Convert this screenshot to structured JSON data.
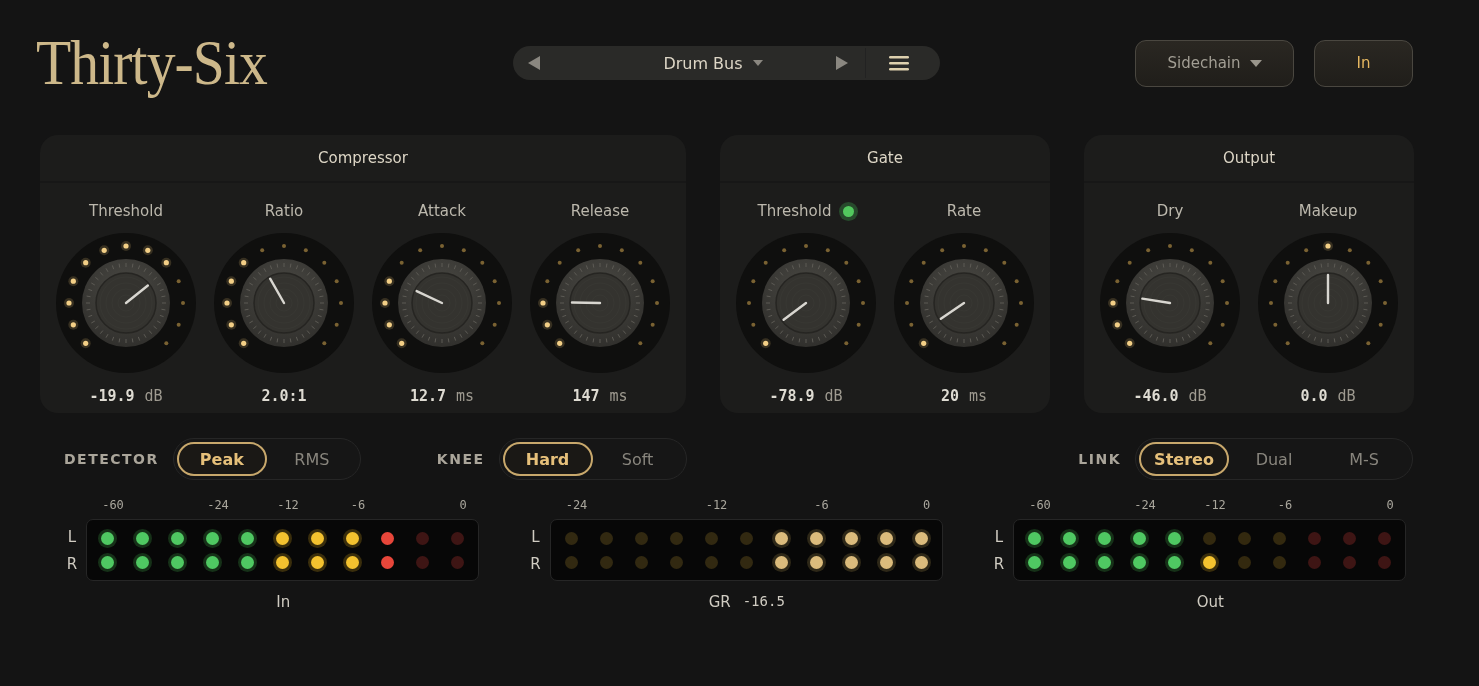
{
  "header": {
    "title": "Thirty-Six",
    "preset": {
      "name": "Drum Bus"
    },
    "sidechain": {
      "label": "Sidechain"
    },
    "bypass": {
      "label": "In",
      "on": true
    }
  },
  "sections": [
    {
      "title": "Compressor",
      "knobs": [
        {
          "label": "Threshold",
          "value": "-19.9",
          "unit": "dB"
        },
        {
          "label": "Ratio",
          "value": "2.0:1"
        },
        {
          "label": "Attack",
          "value": "12.7",
          "unit": "ms"
        },
        {
          "label": "Release",
          "value": "147",
          "unit": "ms"
        }
      ]
    },
    {
      "title": "Gate",
      "knobs": [
        {
          "label": "Threshold",
          "indicator": {
            "on": true
          },
          "value": "-78.9",
          "unit": "dB"
        },
        {
          "label": "Rate",
          "value": "20",
          "unit": "ms"
        }
      ]
    },
    {
      "title": "Output",
      "knobs": [
        {
          "label": "Dry",
          "value": "-46.0",
          "unit": "dB"
        },
        {
          "label": "Makeup",
          "value": "0.0",
          "unit": "dB"
        }
      ]
    }
  ],
  "modes": [
    {
      "label": "DETECTOR",
      "options": [
        {
          "label": "Peak",
          "selected": true
        },
        {
          "label": "RMS",
          "selected": false
        }
      ]
    },
    {
      "label": "KNEE",
      "options": [
        {
          "label": "Hard",
          "selected": true
        },
        {
          "label": "Soft",
          "selected": false
        }
      ]
    },
    {
      "label": "LINK",
      "options": [
        {
          "label": "Stereo",
          "selected": true
        },
        {
          "label": "Dual",
          "selected": false
        },
        {
          "label": "M-S",
          "selected": false
        }
      ]
    }
  ],
  "meters": [
    {
      "kind": "level",
      "ticks": [
        "-60",
        "-24",
        "-12",
        "-6",
        "0"
      ],
      "channels": [
        {
          "label": "L",
          "level": 0.818
        },
        {
          "label": "R",
          "level": 0.818
        }
      ],
      "caption": "In"
    },
    {
      "kind": "reduction",
      "ticks": [
        "-24",
        "-12",
        "-6",
        "0"
      ],
      "channels": [
        {
          "label": "L",
          "level": 0.455
        },
        {
          "label": "R",
          "level": 0.455
        }
      ],
      "caption": "GR",
      "reading": "-16.5"
    },
    {
      "kind": "level",
      "ticks": [
        "-60",
        "-24",
        "-12",
        "-6",
        "0"
      ],
      "channels": [
        {
          "label": "L",
          "level": 0.455
        },
        {
          "label": "R",
          "level": 0.545
        }
      ],
      "caption": "Out"
    }
  ]
}
